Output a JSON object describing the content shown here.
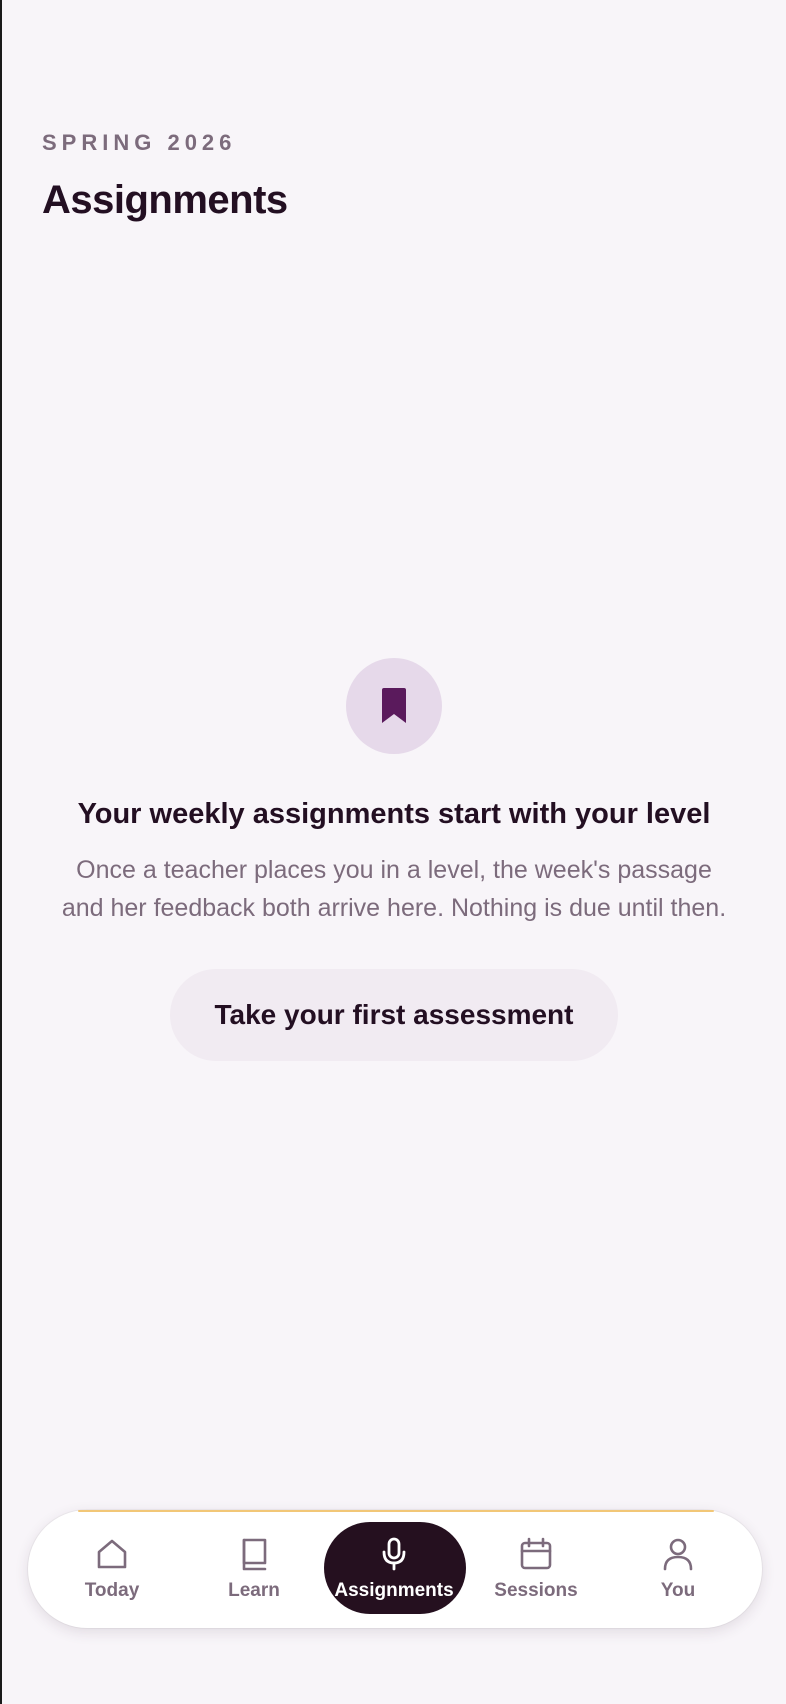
{
  "header": {
    "eyebrow": "SPRING 2026",
    "title": "Assignments"
  },
  "empty_state": {
    "icon": "bookmark-icon",
    "title": "Your weekly assignments start with your level",
    "body": "Once a teacher places you in a level, the week's passage and her feedback both arrive here. Nothing is due until then.",
    "cta_label": "Take your first assessment"
  },
  "tabbar": {
    "active": "Assignments",
    "items": [
      {
        "label": "Today",
        "icon": "home-icon"
      },
      {
        "label": "Learn",
        "icon": "book-icon"
      },
      {
        "label": "Assignments",
        "icon": "microphone-icon"
      },
      {
        "label": "Sessions",
        "icon": "calendar-icon"
      },
      {
        "label": "You",
        "icon": "person-icon"
      }
    ]
  },
  "colors": {
    "background": "#f8f5f9",
    "ink": "#230f22",
    "muted": "#7c6b7c",
    "accent": "#5a1a5c",
    "badge": "#e6d9ea",
    "active_pill": "#25101f",
    "tabbar_accent": "#f2c777"
  }
}
